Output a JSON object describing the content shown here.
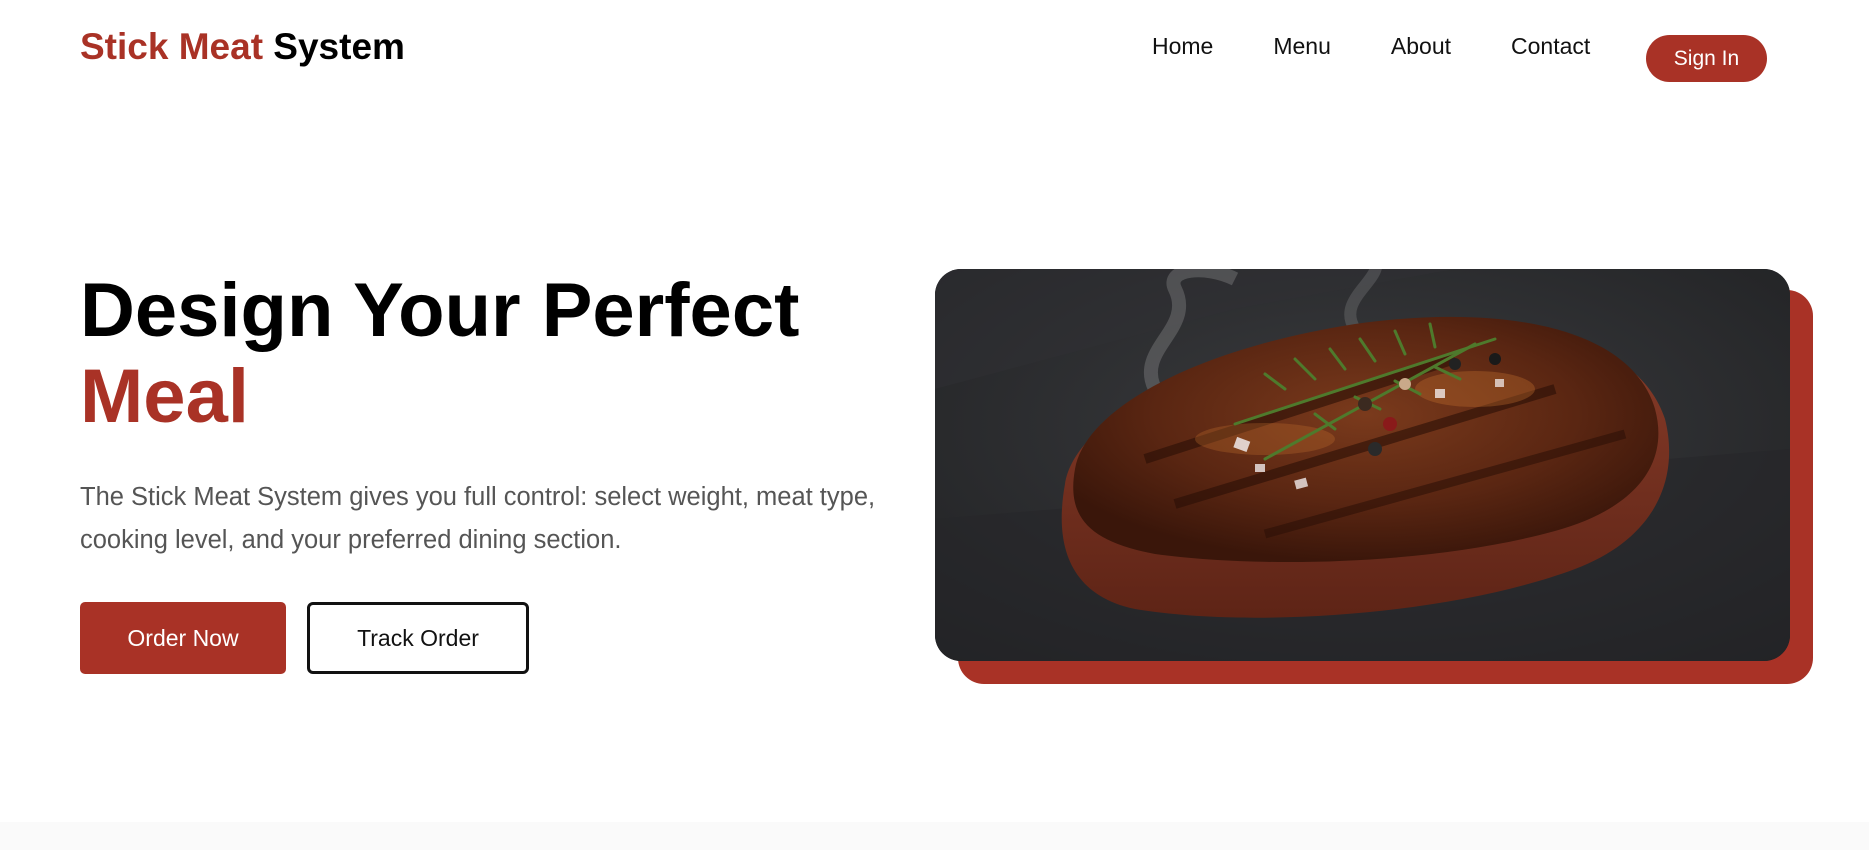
{
  "brand": {
    "accent": "Stick Meat",
    "rest": "System",
    "accent_color": "#a93226"
  },
  "nav": {
    "links": [
      "Home",
      "Menu",
      "About",
      "Contact"
    ],
    "sign_in": "Sign In"
  },
  "hero": {
    "headline_line1": "Design Your Perfect",
    "headline_line2": "Meal",
    "subtitle": "The Stick Meat System gives you full control: select weight, meat type, cooking level, and your preferred dining section.",
    "primary_button": "Order Now",
    "secondary_button": "Track Order"
  },
  "image": {
    "subject": "grilled steak with rosemary on dark slate"
  }
}
